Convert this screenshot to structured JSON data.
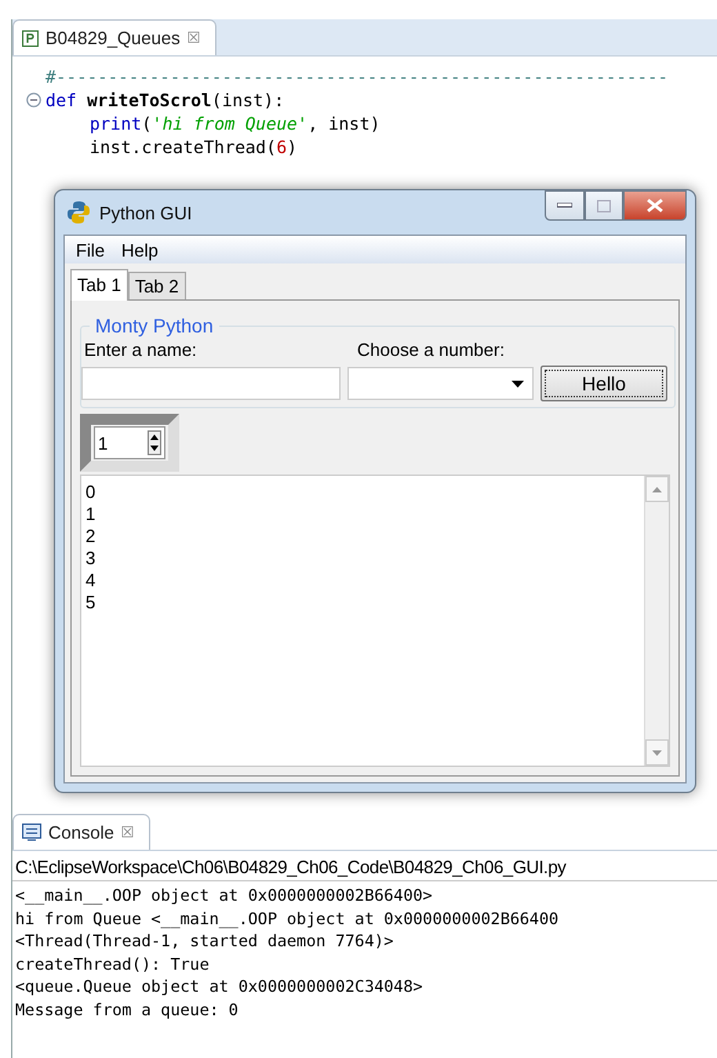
{
  "editor": {
    "tab": {
      "label": "B04829_Queues",
      "close": "☒"
    },
    "lines": [
      {
        "fold": false,
        "tokens": [
          {
            "kind": "comment",
            "text": "#-----------------------------------------------------------"
          }
        ]
      },
      {
        "fold": true,
        "tokens": [
          {
            "kind": "keyword",
            "text": "def "
          },
          {
            "kind": "name",
            "text": "writeToScrol"
          },
          {
            "kind": "plain",
            "text": "(inst):"
          }
        ],
        "children": [
          {
            "fold": false,
            "tokens": [
              {
                "kind": "keyword",
                "text": "print"
              },
              {
                "kind": "plain",
                "text": "("
              },
              {
                "kind": "string",
                "text": "'hi from Queue'"
              },
              {
                "kind": "plain",
                "text": ", inst)"
              }
            ]
          },
          {
            "fold": false,
            "tokens": [
              {
                "kind": "plain",
                "text": "inst.createThread("
              },
              {
                "kind": "number",
                "text": "6"
              },
              {
                "kind": "plain",
                "text": ")"
              }
            ]
          }
        ]
      }
    ]
  },
  "gui": {
    "title": "Python GUI",
    "menu": [
      "File",
      "Help"
    ],
    "tabs": [
      {
        "label": "Tab 1",
        "selected": true
      },
      {
        "label": "Tab 2",
        "selected": false
      }
    ],
    "group": "Monty Python",
    "name_label": "Enter a name:",
    "number_label": "Choose a number:",
    "button": "Hello",
    "spinner": "1",
    "text_lines": [
      "0",
      "1",
      "2",
      "3",
      "4",
      "5"
    ]
  },
  "console": {
    "tab": {
      "label": "Console",
      "close": "☒"
    },
    "path": "C:\\EclipseWorkspace\\Ch06\\B04829_Ch06_Code\\B04829_Ch06_GUI.py",
    "lines": [
      "<__main__.OOP object at 0x0000000002B66400>",
      "hi from Queue <__main__.OOP object at 0x0000000002B66400",
      "<Thread(Thread-1, started daemon 7764)>",
      "createThread(): True",
      "<queue.Queue object at 0x0000000002C34048>",
      "Message from a queue: 0"
    ]
  }
}
